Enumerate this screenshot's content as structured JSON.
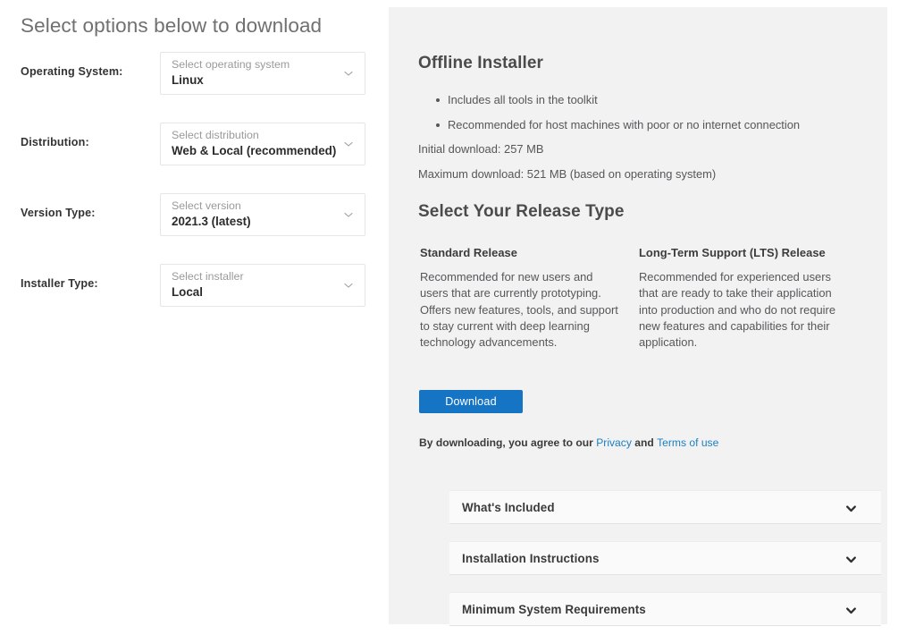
{
  "left": {
    "title": "Select options below to download",
    "options": [
      {
        "label": "Operating System:",
        "placeholder": "Select operating system",
        "value": "Linux",
        "name": "operating-system"
      },
      {
        "label": "Distribution:",
        "placeholder": "Select distribution",
        "value": "Web & Local (recommended)",
        "name": "distribution"
      },
      {
        "label": "Version Type:",
        "placeholder": "Select version",
        "value": "2021.3 (latest)",
        "name": "version-type"
      },
      {
        "label": "Installer Type:",
        "placeholder": "Select installer",
        "value": "Local",
        "name": "installer-type"
      }
    ]
  },
  "panel": {
    "installer": {
      "heading": "Offline Installer",
      "bullets": [
        "Includes all tools in the toolkit",
        "Recommended for host machines with poor or no internet connection"
      ],
      "initial_download": "Initial download: 257 MB",
      "maximum_download": "Maximum download: 521 MB (based on operating system)"
    },
    "release": {
      "heading": "Select Your Release Type",
      "columns": [
        {
          "title": "Standard Release",
          "body": "Recommended for new users and users that are currently prototyping. Offers new features, tools, and support to stay current with deep learning technology advancements."
        },
        {
          "title": "Long-Term Support (LTS) Release",
          "body": "Recommended for experienced users that are ready to take their application into production and who do not require new features and capabilities for their application."
        }
      ]
    },
    "download_button": "Download",
    "agreement": {
      "prefix": "By downloading, you agree to our ",
      "privacy_link": "Privacy",
      "middle": " and ",
      "terms_link": "Terms of use"
    },
    "accordions": [
      {
        "label": "What's Included",
        "name": "whats-included"
      },
      {
        "label": "Installation Instructions",
        "name": "installation-instructions"
      },
      {
        "label": "Minimum System Requirements",
        "name": "minimum-system-requirements"
      }
    ]
  },
  "colors": {
    "panel_background": "#f2f2f2",
    "accent_blue": "#1574c4",
    "link_blue": "#1a7fc1",
    "heading_gray": "#6f7071",
    "body_gray": "#555759"
  },
  "icons": {
    "select_chevron": "chevron-down-icon",
    "accordion_chevron": "chevron-down-icon"
  }
}
